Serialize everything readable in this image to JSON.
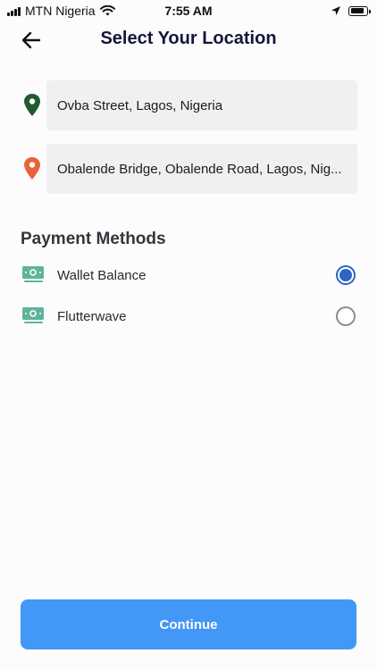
{
  "status_bar": {
    "carrier": "MTN Nigeria",
    "time": "7:55 AM",
    "icons": [
      "signal-icon",
      "wifi-icon",
      "location-arrow-icon",
      "battery-icon"
    ]
  },
  "header": {
    "title": "Select Your Location",
    "back_icon": "arrow-left-icon"
  },
  "locations": {
    "pickup": {
      "value": "Ovba Street, Lagos, Nigeria",
      "pin_color": "#1f5b2c"
    },
    "destination": {
      "value": "Obalende Bridge, Obalende Road, Lagos, Nig...",
      "pin_color": "#e8633a"
    }
  },
  "payment": {
    "title": "Payment Methods",
    "options": [
      {
        "label": "Wallet Balance",
        "selected": true,
        "icon": "cash-icon"
      },
      {
        "label": "Flutterwave",
        "selected": false,
        "icon": "cash-icon"
      }
    ]
  },
  "actions": {
    "continue_label": "Continue"
  },
  "colors": {
    "accent": "#4297f7",
    "radio_selected": "#2e66c4",
    "title": "#14163a",
    "money_icon": "#5fb49c"
  }
}
